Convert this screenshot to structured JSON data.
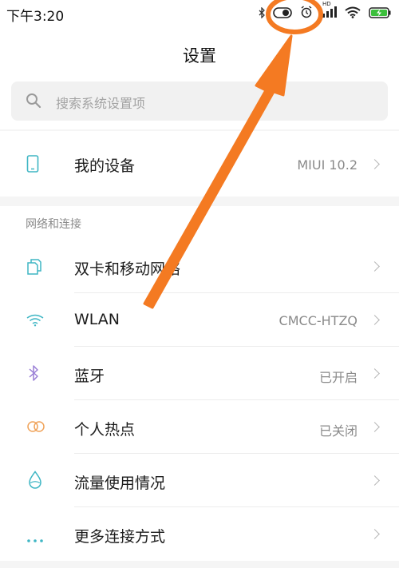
{
  "status_bar": {
    "time": "下午3:20",
    "icons": [
      "bluetooth-icon",
      "toggle-icon",
      "alarm-icon",
      "signal-hd-icon",
      "wifi-icon",
      "battery-charging-icon"
    ],
    "signal_badge": "HD"
  },
  "header": {
    "title": "设置"
  },
  "search": {
    "placeholder": "搜索系统设置项"
  },
  "top_item": {
    "label": "我的设备",
    "value": "MIUI 10.2",
    "icon": "phone-icon"
  },
  "section": {
    "header": "网络和连接",
    "items": [
      {
        "label": "双卡和移动网络",
        "value": "",
        "icon": "sim-cards-icon"
      },
      {
        "label": "WLAN",
        "value": "CMCC-HTZQ",
        "icon": "wifi-icon"
      },
      {
        "label": "蓝牙",
        "value": "已开启",
        "icon": "bluetooth-icon"
      },
      {
        "label": "个人热点",
        "value": "已关闭",
        "icon": "hotspot-icon"
      },
      {
        "label": "流量使用情况",
        "value": "",
        "icon": "data-usage-icon"
      },
      {
        "label": "更多连接方式",
        "value": "",
        "icon": "more-dots-icon"
      }
    ]
  },
  "colors": {
    "annotation": "#f47a22",
    "icon_teal": "#3fb6c4",
    "icon_purple": "#9a7fd6",
    "icon_orange": "#f0a35a"
  }
}
